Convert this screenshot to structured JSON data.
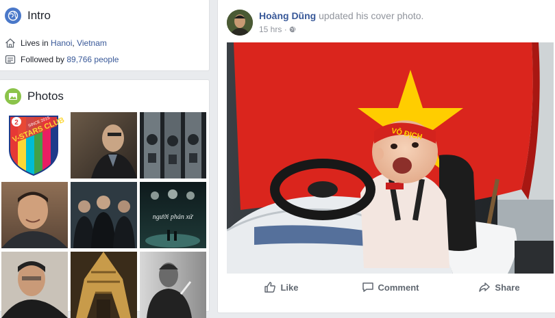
{
  "intro": {
    "title": "Intro",
    "lives_prefix": "Lives in",
    "lives_city": "Hanoi",
    "lives_sep": ", ",
    "lives_country": "Vietnam",
    "followed_prefix": "Followed by",
    "followers": "89,766 people"
  },
  "photos": {
    "title": "Photos",
    "badge_year": "2",
    "badge_since": "SINCE 2015",
    "badge_name": "V-STARS CLUB",
    "poster_text": "người phán xử"
  },
  "post": {
    "author": "Hoàng Dũng",
    "action": "updated his cover photo.",
    "time": "15 hrs",
    "meta_sep": " · ",
    "headband_text": "VÔ ĐỊCH",
    "actions": {
      "like": "Like",
      "comment": "Comment",
      "share": "Share"
    }
  },
  "colors": {
    "link": "#385898",
    "flag_red": "#da251d",
    "flag_star": "#ffcd00"
  }
}
